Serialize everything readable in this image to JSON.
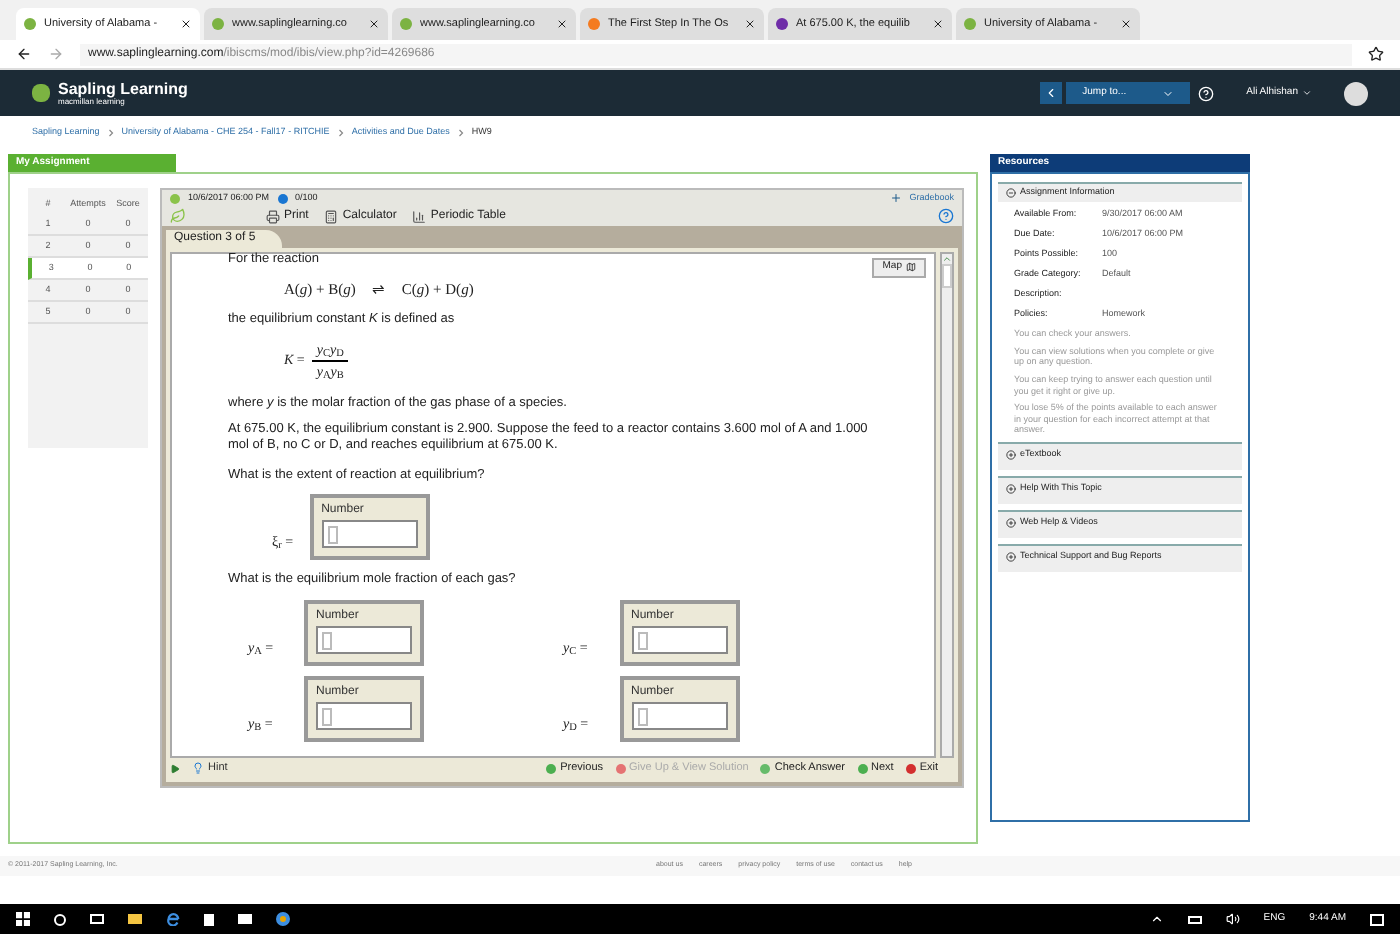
{
  "browser": {
    "tabs": [
      {
        "title": "University of Alabama - ",
        "selected": true,
        "kind": "sapling"
      },
      {
        "title": "www.saplinglearning.co",
        "selected": false,
        "kind": "sapling"
      },
      {
        "title": "www.saplinglearning.co",
        "selected": false,
        "kind": "sapling"
      },
      {
        "title": "The First Step In The Os",
        "selected": false,
        "kind": "chegg"
      },
      {
        "title": "At 675.00 K, the equilib",
        "selected": false,
        "kind": "yahoo"
      },
      {
        "title": "University of Alabama - ",
        "selected": false,
        "kind": "sapling"
      }
    ],
    "url_host": "www.saplinglearning.com",
    "url_path": "/ibiscms/mod/ibis/view.php?id=4269686"
  },
  "navbar": {
    "brand": "Sapling Learning",
    "brand_sub": "macmillan learning",
    "jump": "Jump to...",
    "user": "Ali Alhishan"
  },
  "breadcrumb": [
    "Sapling Learning",
    "University of Alabama - CHE 254 - Fall17 - RITCHIE",
    "Activities and Due Dates",
    "HW9"
  ],
  "assignment": {
    "title": "My Assignment",
    "columns": [
      "#",
      "Attempts",
      "Score"
    ],
    "rows": [
      {
        "num": "1",
        "attempts": "0",
        "score": "0",
        "selected": false
      },
      {
        "num": "2",
        "attempts": "0",
        "score": "0",
        "selected": false
      },
      {
        "num": "3",
        "attempts": "0",
        "score": "0",
        "selected": true
      },
      {
        "num": "4",
        "attempts": "0",
        "score": "0",
        "selected": false
      },
      {
        "num": "5",
        "attempts": "0",
        "score": "0",
        "selected": false
      }
    ]
  },
  "question": {
    "due": "10/6/2017 06:00 PM",
    "points": "0/100",
    "gradebook": "Gradebook",
    "tools": [
      "Print",
      "Calculator",
      "Periodic Table"
    ],
    "tab": "Question 3 of 5",
    "map": "Map",
    "intro": "For the reaction",
    "equation": {
      "left": "A(*g*) + B(*g*)",
      "arrow": "⇌",
      "right": "C(*g*) + D(*g*)"
    },
    "k_text": "the equilibrium constant *K* is defined as",
    "k_lhs": "*K* =",
    "k_num": "*y*$_{C}$*y*$_{D}$",
    "k_den": "*y*$_{A}$*y*$_{B}$",
    "where": "where *y* is the molar fraction of the gas phase of a species.",
    "problem": "At 675.00 K, the equilibrium constant is 2.900. Suppose the feed to a reactor contains 3.600 mol of A and 1.000 mol of B, no C or D, and reaches equilibrium at 675.00 K.",
    "q1": "What is the extent of reaction at equilibrium?",
    "extent": {
      "label": "ξ$_{r}$ =",
      "field_title": "Number"
    },
    "q2": "What is the equilibrium mole fraction of each gas?",
    "fractions": [
      {
        "label": "*y*$_{A}$ =",
        "field_title": "Number"
      },
      {
        "label": "*y*$_{C}$ =",
        "field_title": "Number"
      },
      {
        "label": "*y*$_{B}$ =",
        "field_title": "Number"
      },
      {
        "label": "*y*$_{D}$ =",
        "field_title": "Number"
      }
    ],
    "hint": "Hint",
    "actions": [
      {
        "label": "Previous",
        "kind": "previous",
        "disabled": false
      },
      {
        "label": "Give Up & View Solution",
        "kind": "giveup",
        "disabled": true
      },
      {
        "label": "Check Answer",
        "kind": "check",
        "disabled": false
      },
      {
        "label": "Next",
        "kind": "next",
        "disabled": false
      },
      {
        "label": "Exit",
        "kind": "exit",
        "disabled": false
      }
    ]
  },
  "resources": {
    "title": "Resources",
    "info_title": "Assignment Information",
    "info": [
      {
        "label": "Available From:",
        "value": "9/30/2017 06:00 AM"
      },
      {
        "label": "Due Date:",
        "value": "10/6/2017 06:00 PM"
      },
      {
        "label": "Points Possible:",
        "value": "100"
      },
      {
        "label": "Grade Category:",
        "value": "Default"
      },
      {
        "label": "Description:"
      },
      {
        "label": "Policies:",
        "value": "Homework"
      }
    ],
    "policies": [
      "You can check your answers.",
      "You can view solutions when you complete or give up on any question.",
      "You can keep trying to answer each question until you get it right or give up.",
      "You lose 5% of the points available to each answer in your question for each incorrect attempt at that answer."
    ],
    "sections": [
      "eTextbook",
      "Help With This Topic",
      "Web Help & Videos",
      "Technical Support and Bug Reports"
    ]
  },
  "footer": {
    "copyright": "© 2011-2017 Sapling Learning, Inc.",
    "links": [
      "about us",
      "careers",
      "privacy policy",
      "terms of use",
      "contact us",
      "help"
    ]
  },
  "taskbar": {
    "lang": "ENG",
    "time": "9:44 AM"
  }
}
